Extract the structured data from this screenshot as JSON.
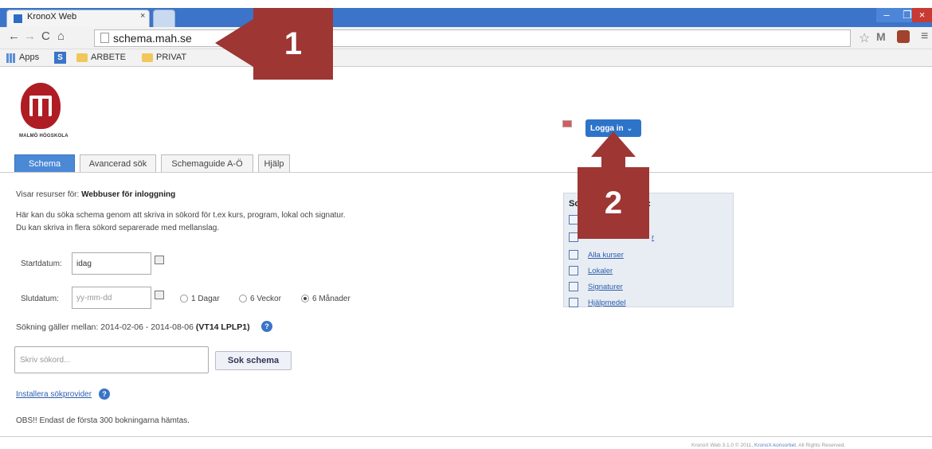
{
  "browser": {
    "tab_title": "KronoX Web",
    "tab_close": "×",
    "url": "schema.mah.se",
    "bookmarks": {
      "apps": "Apps",
      "s_icon": "S",
      "arbete": "ARBETE",
      "privat": "PRIVAT"
    },
    "window": {
      "min": "–",
      "max": "❐",
      "close": "×"
    },
    "nav_icons": {
      "back": "←",
      "forward": "→",
      "reload": "C",
      "home": "⌂"
    },
    "toolbar_icons": {
      "star": "☆",
      "gmail": "M",
      "menu": "≡"
    }
  },
  "callouts": {
    "one": "1",
    "two": "2"
  },
  "header": {
    "logo_text": "MALMÖ HÖGSKOLA",
    "login_label": "Logga in",
    "login_chevron": "⌄"
  },
  "tabs": [
    {
      "label": "Schema"
    },
    {
      "label": "Avancerad sök"
    },
    {
      "label": "Schemaguide A-Ö"
    },
    {
      "label": "Hjälp"
    }
  ],
  "main": {
    "resources_prefix": "Visar resurser för: ",
    "resources_name": "Webbuser för inloggning",
    "intro_line1": "Här kan du söka schema genom att skriva in sökord för t.ex kurs, program, lokal och signatur.",
    "intro_line2": "Du kan skriva in flera sökord separerade med mellanslag.",
    "start_label": "Startdatum:",
    "start_value": "idag",
    "end_label": "Slutdatum:",
    "end_placeholder": "yy-mm-dd",
    "radio_days": "1 Dagar",
    "radio_weeks": "6 Veckor",
    "radio_months": "6 Månader",
    "range_prefix": "Sökning gäller mellan: 2014-02-06 - 2014-08-06 ",
    "range_term": "(VT14 LPLP1)",
    "search_placeholder": "Skriv sökord...",
    "search_button": "Sok schema",
    "install_link": "Installera sökprovider",
    "help_glyph": "?",
    "obs": "OBS!! Endast de första 300 bokningarna hämtas."
  },
  "panel": {
    "title": "Sc",
    "title_end": ":",
    "link2": "r",
    "links": [
      "Alla kurser",
      "Lokaler",
      "Signaturer",
      "Hjälpmedel"
    ]
  },
  "footer": {
    "prefix": "KronoX Web 3.1.0 © 2011, ",
    "link": "KronoX-konsortiet",
    "suffix": ". All Rights Reserved."
  },
  "colors": {
    "brand_red": "#b01c24",
    "callout": "#9e3633",
    "accent_blue": "#2d74c9"
  }
}
